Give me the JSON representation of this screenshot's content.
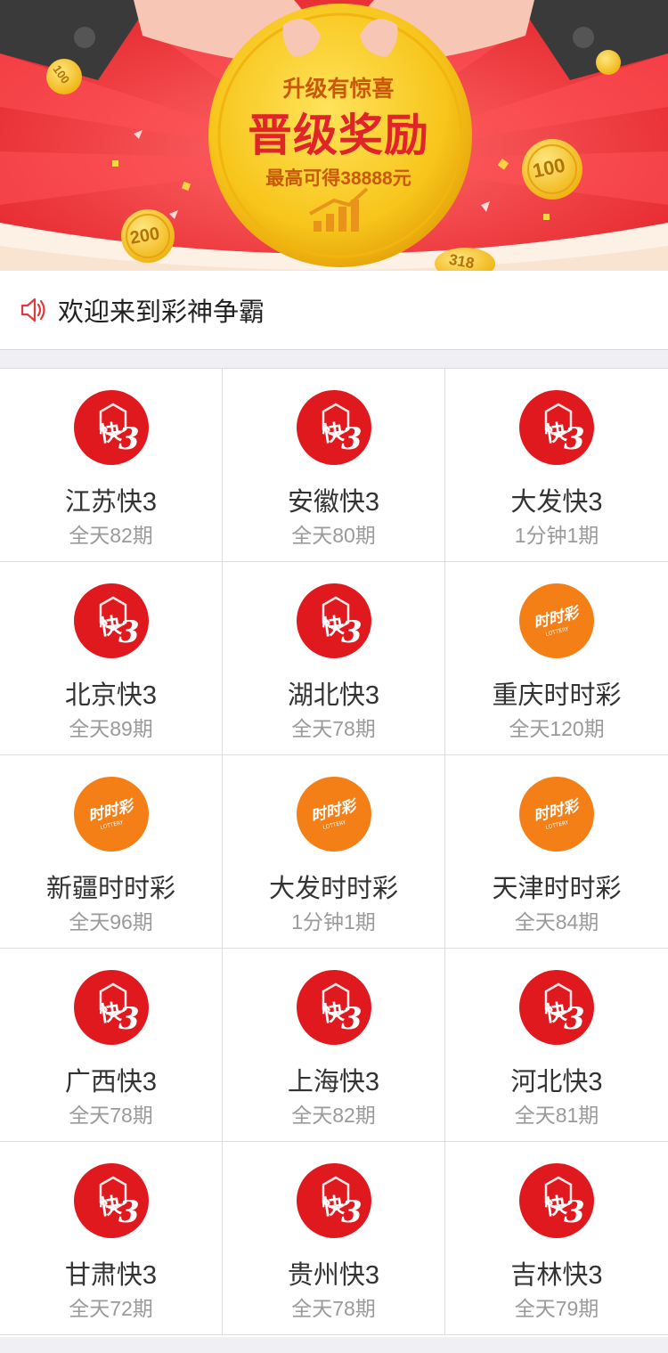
{
  "banner": {
    "line1": "升级有惊喜",
    "line2": "晋级奖励",
    "line3": "最高可得38888元",
    "coins": [
      "200",
      "100",
      "318",
      "100"
    ],
    "colors": {
      "red": "#f0373c",
      "gold": "#f5c518",
      "coin_text": "#b27406"
    }
  },
  "notice": {
    "icon": "speaker-icon",
    "text": "欢迎来到彩神争霸"
  },
  "games": [
    {
      "name": "江苏快3",
      "period": "全天82期",
      "icon": "k3"
    },
    {
      "name": "安徽快3",
      "period": "全天80期",
      "icon": "k3"
    },
    {
      "name": "大发快3",
      "period": "1分钟1期",
      "icon": "k3"
    },
    {
      "name": "北京快3",
      "period": "全天89期",
      "icon": "k3"
    },
    {
      "name": "湖北快3",
      "period": "全天78期",
      "icon": "k3"
    },
    {
      "name": "重庆时时彩",
      "period": "全天120期",
      "icon": "ssc"
    },
    {
      "name": "新疆时时彩",
      "period": "全天96期",
      "icon": "ssc"
    },
    {
      "name": "大发时时彩",
      "period": "1分钟1期",
      "icon": "ssc"
    },
    {
      "name": "天津时时彩",
      "period": "全天84期",
      "icon": "ssc"
    },
    {
      "name": "广西快3",
      "period": "全天78期",
      "icon": "k3"
    },
    {
      "name": "上海快3",
      "period": "全天82期",
      "icon": "k3"
    },
    {
      "name": "河北快3",
      "period": "全天81期",
      "icon": "k3"
    },
    {
      "name": "甘肃快3",
      "period": "全天72期",
      "icon": "k3"
    },
    {
      "name": "贵州快3",
      "period": "全天78期",
      "icon": "k3"
    },
    {
      "name": "吉林快3",
      "period": "全天79期",
      "icon": "k3"
    }
  ],
  "logo_text": {
    "k3": "快",
    "k3_digit": "3",
    "ssc": "时时彩",
    "ssc_sub": "LOTTERY"
  }
}
